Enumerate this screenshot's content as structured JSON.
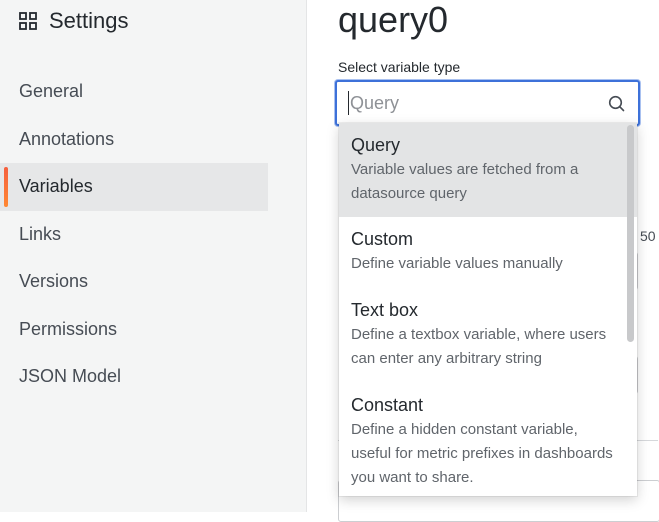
{
  "sidebar": {
    "title": "Settings",
    "icon": "grid-icon",
    "items": [
      {
        "label": "General",
        "active": false
      },
      {
        "label": "Annotations",
        "active": false
      },
      {
        "label": "Variables",
        "active": true
      },
      {
        "label": "Links",
        "active": false
      },
      {
        "label": "Versions",
        "active": false
      },
      {
        "label": "Permissions",
        "active": false
      },
      {
        "label": "JSON Model",
        "active": false
      }
    ]
  },
  "main": {
    "title": "query0",
    "select_label": "Select variable type",
    "select_placeholder": "Query",
    "background_fragment": "50"
  },
  "dropdown": {
    "options": [
      {
        "label": "Query",
        "description": "Variable values are fetched from a datasource query",
        "highlighted": true
      },
      {
        "label": "Custom",
        "description": "Define variable values manually",
        "highlighted": false
      },
      {
        "label": "Text box",
        "description": "Define a textbox variable, where users can enter any arbitrary string",
        "highlighted": false
      },
      {
        "label": "Constant",
        "description": "Define a hidden constant variable, useful for metric prefixes in dashboards you want to share.",
        "highlighted": false
      }
    ]
  },
  "colors": {
    "accent": "#3d71d9",
    "active_indicator": "#f55f3e",
    "sidebar_bg": "#f4f5f5"
  }
}
